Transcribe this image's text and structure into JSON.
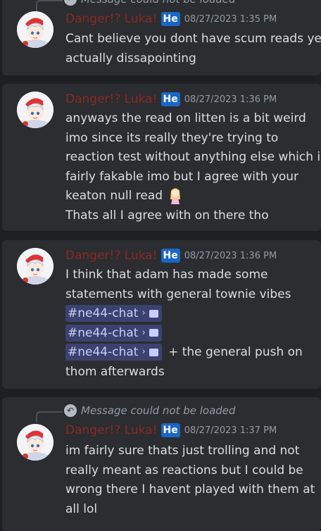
{
  "messages": [
    {
      "reply": "Message could not be loaded",
      "author": "Danger!? Luka!",
      "tag": "He",
      "timestamp": "08/27/2023 1:35 PM",
      "lines": [
        "Cant believe you dont have scum reads yet",
        "actually dissapointing"
      ]
    },
    {
      "author": "Danger!? Luka!",
      "tag": "He",
      "timestamp": "08/27/2023 1:36 PM",
      "lines": [
        "anyways the read on litten is a bit weird",
        "imo since its really they're trying to",
        "reaction test without anything else which is",
        "fairly fakable imo but I agree with your",
        "keaton null read",
        "Thats all I agree with on there tho"
      ],
      "emoji": "girl-sticker-emoji"
    },
    {
      "author": "Danger!? Luka!",
      "tag": "He",
      "timestamp": "08/27/2023 1:36 PM",
      "lines": [
        "I think that adam has made some",
        "statements with general townie vibes"
      ],
      "channels": [
        "#ne44-chat",
        "#ne44-chat",
        "#ne44-chat"
      ],
      "after_channels": "+ the general push on",
      "last_line": "thom afterwards"
    },
    {
      "reply": "Message could not be loaded",
      "author": "Danger!? Luka!",
      "tag": "He",
      "timestamp": "08/27/2023 1:37 PM",
      "lines": [
        "im fairly sure thats just trolling and not",
        "really meant as reactions but I could be",
        "wrong there I havent played with them at",
        "all lol"
      ]
    }
  ],
  "colors": {
    "author": "#8b2a22",
    "tag": "#1a66c7",
    "mention_bg": "#3c4270"
  },
  "icons": [
    "reply-arrow-icon",
    "avatar",
    "channel-chevron-icon",
    "thread-bubble-icon"
  ]
}
